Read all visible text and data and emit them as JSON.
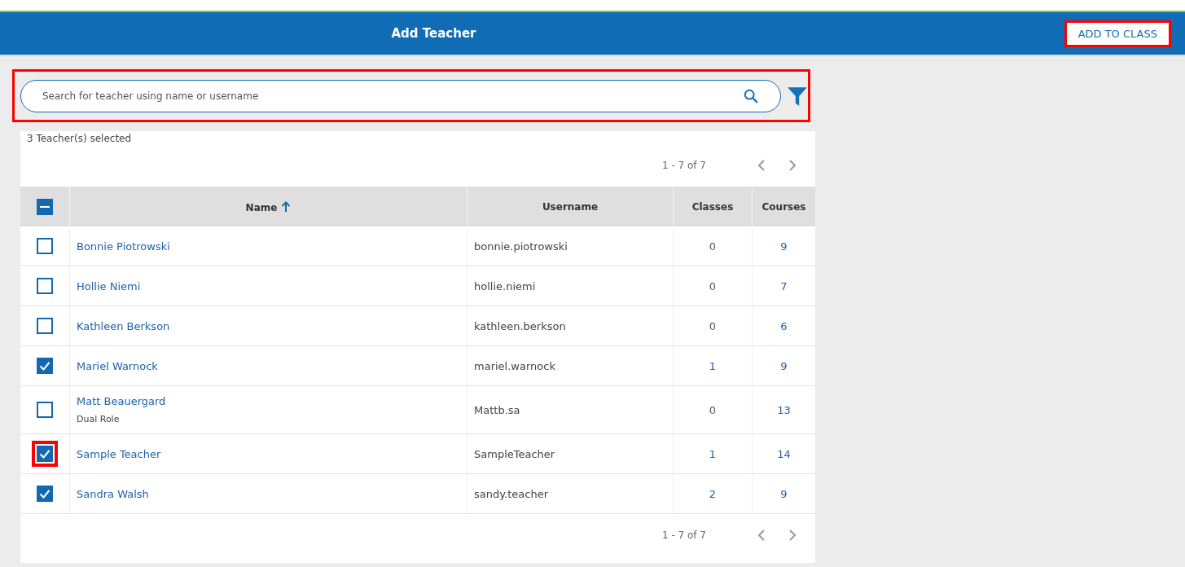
{
  "header": {
    "title": "Add Teacher",
    "action": {
      "label": "ADD TO CLASS",
      "highlighted": true
    }
  },
  "search": {
    "placeholder": "Search for teacher using name or username",
    "highlighted": true
  },
  "selection_summary": "3 Teacher(s) selected",
  "pagination_top": "1 - 7 of 7",
  "table": {
    "select_all": {
      "indeterminate": true
    },
    "columns": [
      {
        "label": "Name",
        "sorted": true
      },
      {
        "label": "Username",
        "sorted": false
      },
      {
        "label": "Classes",
        "sorted": false
      },
      {
        "label": "Courses",
        "sorted": false
      }
    ],
    "rows": [
      {
        "checked": false,
        "highlighted": false,
        "name": "Bonnie Piotrowski",
        "username": "bonnie.piotrowski",
        "classes": "0",
        "classes_linked": false,
        "courses": "9"
      },
      {
        "checked": false,
        "highlighted": false,
        "name": "Hollie Niemi",
        "username": "hollie.niemi",
        "classes": "0",
        "classes_linked": false,
        "courses": "7"
      },
      {
        "checked": false,
        "highlighted": false,
        "name": "Kathleen Berkson",
        "username": "kathleen.berkson",
        "classes": "0",
        "classes_linked": false,
        "courses": "6"
      },
      {
        "checked": true,
        "highlighted": false,
        "name": "Mariel Warnock",
        "username": "mariel.warnock",
        "classes": "1",
        "classes_linked": true,
        "courses": "9"
      },
      {
        "checked": false,
        "highlighted": false,
        "name": "Matt Beauergard",
        "role": "Dual Role",
        "username": "Mattb.sa",
        "classes": "0",
        "classes_linked": false,
        "courses": "13"
      },
      {
        "checked": true,
        "highlighted": true,
        "name": "Sample Teacher",
        "username": "SampleTeacher",
        "classes": "1",
        "classes_linked": true,
        "courses": "14"
      },
      {
        "checked": true,
        "highlighted": false,
        "name": "Sandra Walsh",
        "username": "sandy.teacher",
        "classes": "2",
        "classes_linked": true,
        "courses": "9"
      }
    ]
  },
  "pagination_bottom": "1 - 7 of 7"
}
